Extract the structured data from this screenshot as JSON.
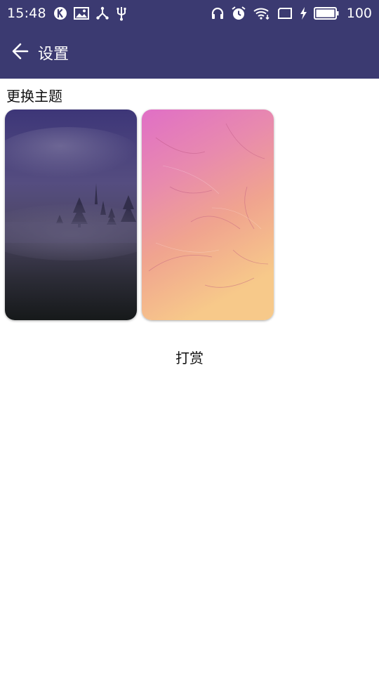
{
  "status_bar": {
    "time": "15:48",
    "battery_level": "100",
    "left_icons": [
      "k-app-icon",
      "image-icon",
      "share-icon",
      "usb-icon"
    ],
    "right_icons": [
      "headphones-icon",
      "alarm-icon",
      "wifi-icon",
      "screen-icon",
      "charging-icon",
      "battery-icon"
    ]
  },
  "app_bar": {
    "back_icon": "arrow-left-icon",
    "title": "设置",
    "background": "#3b3a71"
  },
  "theme_section": {
    "title": "更换主题",
    "themes": [
      {
        "name": "fog-forest",
        "colors": [
          "#3d3678",
          "#4a4466",
          "#16191a"
        ]
      },
      {
        "name": "pink-feather",
        "colors": [
          "#e278c4",
          "#f0a394",
          "#f7c68a"
        ]
      }
    ]
  },
  "tip": {
    "label": "打赏"
  }
}
